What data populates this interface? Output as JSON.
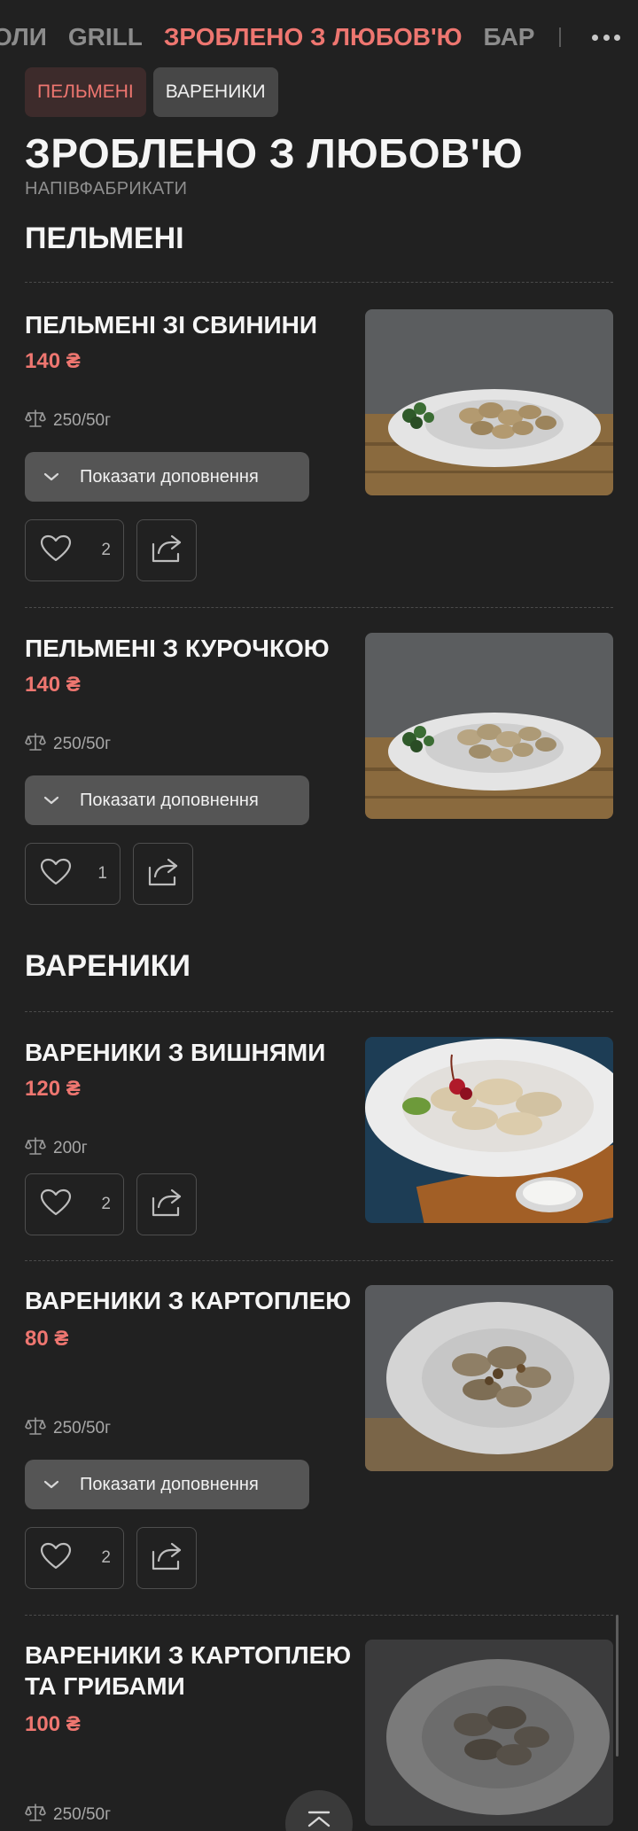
{
  "nav": {
    "items": [
      {
        "label": "ОЛИ",
        "active": false
      },
      {
        "label": "GRILL",
        "active": false
      },
      {
        "label": "ЗРОБЛЕНО З ЛЮБОВ'Ю",
        "active": true
      },
      {
        "label": "БАР",
        "active": false
      }
    ],
    "more_icon": "more-dots-icon"
  },
  "pills": [
    {
      "label": "ПЕЛЬМЕНІ",
      "active": true
    },
    {
      "label": "ВАРЕНИКИ",
      "active": false
    }
  ],
  "page": {
    "title": "ЗРОБЛЕНО З ЛЮБОВ'Ю",
    "subtitle": "НАПІВФАБРИКАТИ"
  },
  "sections": [
    {
      "title": "ПЕЛЬМЕНІ",
      "items": [
        {
          "name": "ПЕЛЬМЕНІ ЗІ СВИНИНИ",
          "price": "140 ₴",
          "weight": "250/50г",
          "addons_label": "Показати доповнення",
          "likes": "2"
        },
        {
          "name": "ПЕЛЬМЕНІ З КУРОЧКОЮ",
          "price": "140 ₴",
          "weight": "250/50г",
          "addons_label": "Показати доповнення",
          "likes": "1"
        }
      ]
    },
    {
      "title": "ВАРЕНИКИ",
      "items": [
        {
          "name": "ВАРЕНИКИ З ВИШНЯМИ",
          "price": "120 ₴",
          "weight": "200г",
          "likes": "2"
        },
        {
          "name": "ВАРЕНИКИ З КАРТОПЛЕЮ",
          "price": "80 ₴",
          "weight": "250/50г",
          "addons_label": "Показати доповнення",
          "likes": "2"
        },
        {
          "name": "ВАРЕНИКИ З КАРТОПЛЕЮ ТА ГРИБАМИ",
          "price": "100 ₴",
          "weight": "250/50г"
        }
      ]
    }
  ],
  "colors": {
    "background": "#212121",
    "accent": "#ee7670",
    "button": "#555555"
  }
}
